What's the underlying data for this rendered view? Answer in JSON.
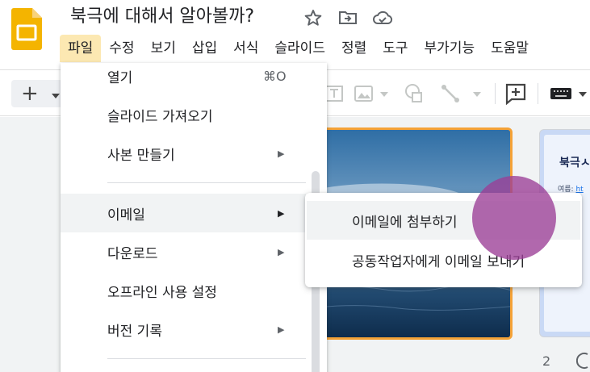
{
  "header": {
    "title": "북극에 대해서 알아볼까?",
    "icons": [
      "star-icon",
      "move-to-folder-icon",
      "cloud-saved-icon"
    ]
  },
  "menubar": {
    "items": [
      {
        "label": "파일",
        "active": true
      },
      {
        "label": "수정"
      },
      {
        "label": "보기"
      },
      {
        "label": "삽입"
      },
      {
        "label": "서식"
      },
      {
        "label": "슬라이드"
      },
      {
        "label": "정렬"
      },
      {
        "label": "도구"
      },
      {
        "label": "부가기능"
      },
      {
        "label": "도움말"
      }
    ]
  },
  "toolbar": {
    "new_label": "+",
    "icons": [
      "text-box-icon",
      "image-icon",
      "shape-icon",
      "line-icon",
      "comment-add-icon",
      "keyboard-icon"
    ]
  },
  "file_menu": {
    "items": [
      {
        "label": "열기",
        "shortcut": "⌘O"
      },
      {
        "label": "슬라이드 가져오기"
      },
      {
        "label": "사본 만들기",
        "submenu": true
      },
      {
        "label": "이메일",
        "submenu": true,
        "highlighted": true
      },
      {
        "label": "다운로드",
        "submenu": true
      },
      {
        "label": "오프라인 사용 설정"
      },
      {
        "label": "버전 기록",
        "submenu": true
      }
    ],
    "arrow": "▶"
  },
  "email_submenu": {
    "items": [
      {
        "label": "이메일에 첨부하기",
        "highlighted": true
      },
      {
        "label": "공동작업자에게 이메일 보내기"
      }
    ]
  },
  "slides": {
    "thumb_title": "북극ㅅ",
    "thumb_sub_prefix": "여름: ",
    "thumb_sub_link": "ht",
    "current_number": "2"
  },
  "colors": {
    "active_menu": "#fce8b2",
    "selected_slide_border": "#f4a237",
    "cursor_highlight": "#9b3e96"
  }
}
